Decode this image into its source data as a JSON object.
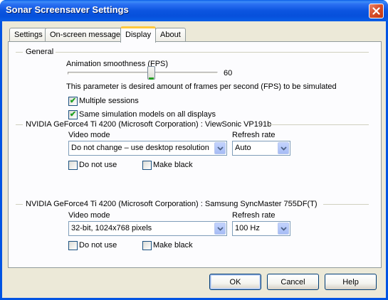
{
  "window": {
    "title": "Sonar Screensaver Settings",
    "close_label": "✕"
  },
  "tabs": [
    {
      "label": "Settings",
      "active": false
    },
    {
      "label": "On-screen message",
      "active": false
    },
    {
      "label": "Display",
      "active": true
    },
    {
      "label": "About",
      "active": false
    }
  ],
  "general": {
    "heading": "General",
    "smoothness_label": "Animation smoothness (FPS)",
    "smoothness_value": "60",
    "smoothness_fraction": 0.56,
    "description": "This parameter is desired amount of frames per second (FPS) to be simulated",
    "multiple_sessions": {
      "label": "Multiple sessions",
      "checked": true
    },
    "same_models": {
      "label": "Same simulation models on all displays",
      "checked": true
    }
  },
  "displays": [
    {
      "heading": "NVIDIA GeForce4 Ti 4200 (Microsoft Corporation) : ViewSonic VP191b",
      "video_mode_label": "Video mode",
      "video_mode_value": "Do not change – use desktop resolution",
      "refresh_label": "Refresh rate",
      "refresh_value": "Auto",
      "do_not_use": {
        "label": "Do not use",
        "checked": false
      },
      "make_black": {
        "label": "Make black",
        "checked": false
      }
    },
    {
      "heading": "NVIDIA GeForce4 Ti 4200 (Microsoft Corporation) : Samsung SyncMaster 755DF(T)",
      "video_mode_label": "Video mode",
      "video_mode_value": "32-bit, 1024x768 pixels",
      "refresh_label": "Refresh rate",
      "refresh_value": "100 Hz",
      "do_not_use": {
        "label": "Do not use",
        "checked": false
      },
      "make_black": {
        "label": "Make black",
        "checked": false
      }
    }
  ],
  "buttons": {
    "ok": "OK",
    "cancel": "Cancel",
    "help": "Help"
  },
  "colors": {
    "titlebar": "#0054e3",
    "close_button": "#d6502e",
    "check_green": "#21a121",
    "tab_highlight": "#ffc83c"
  }
}
